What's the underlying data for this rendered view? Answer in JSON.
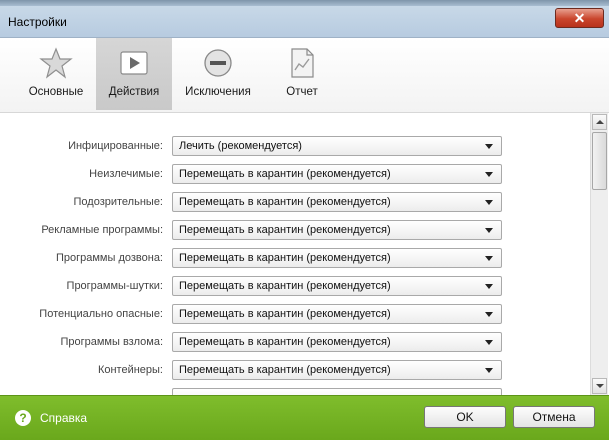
{
  "window": {
    "title": "Настройки",
    "close_glyph": "✕"
  },
  "tabs": [
    {
      "label": "Основные",
      "icon": "star-icon",
      "active": false
    },
    {
      "label": "Действия",
      "icon": "play-icon",
      "active": true
    },
    {
      "label": "Исключения",
      "icon": "minus-circle-icon",
      "active": false
    },
    {
      "label": "Отчет",
      "icon": "report-icon",
      "active": false
    }
  ],
  "actions": [
    {
      "label": "Инфицированные:",
      "value": "Лечить (рекомендуется)"
    },
    {
      "label": "Неизлечимые:",
      "value": "Перемещать в карантин (рекомендуется)"
    },
    {
      "label": "Подозрительные:",
      "value": "Перемещать в карантин (рекомендуется)"
    },
    {
      "label": "Рекламные программы:",
      "value": "Перемещать в карантин (рекомендуется)"
    },
    {
      "label": "Программы дозвона:",
      "value": "Перемещать в карантин (рекомендуется)"
    },
    {
      "label": "Программы-шутки:",
      "value": "Перемещать в карантин (рекомендуется)"
    },
    {
      "label": "Потенциально опасные:",
      "value": "Перемещать в карантин (рекомендуется)"
    },
    {
      "label": "Программы взлома:",
      "value": "Перемещать в карантин (рекомендуется)"
    },
    {
      "label": "Контейнеры:",
      "value": "Перемещать в карантин (рекомендуется)"
    }
  ],
  "footer": {
    "help_label": "Справка",
    "help_glyph": "?",
    "ok_label": "OK",
    "cancel_label": "Отмена"
  },
  "colors": {
    "footer": "#72b024",
    "active_tab": "#cccccc"
  }
}
